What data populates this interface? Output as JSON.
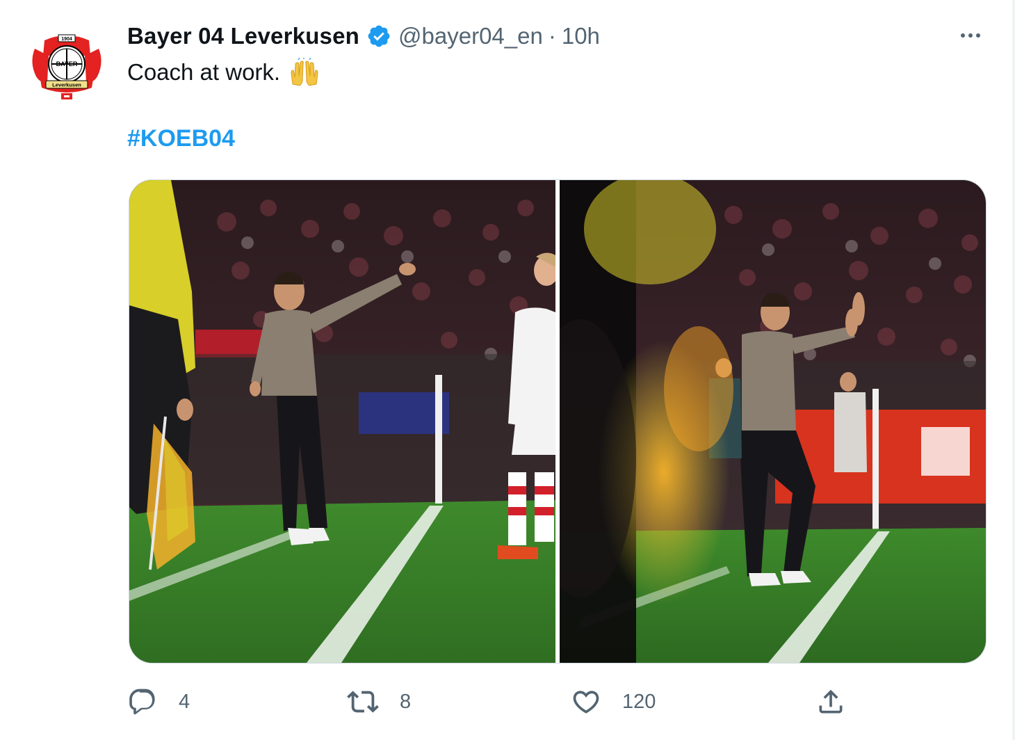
{
  "tweet": {
    "display_name": "Bayer 04 Leverkusen",
    "handle": "@bayer04_en",
    "separator": "·",
    "time": "10h",
    "text": "Coach at work.",
    "emoji": "🙌",
    "hashtag": "#KOEB04",
    "verified": true,
    "avatar_icon": "bayer-leverkusen-crest",
    "crest_text": {
      "top": "1904",
      "middle": "BAYER",
      "bottom": "Leverkusen"
    },
    "photos": [
      {
        "name": "coach-pointing-photo"
      },
      {
        "name": "coach-gesturing-photo"
      }
    ],
    "actions": {
      "reply": {
        "icon": "reply-icon",
        "count": "4"
      },
      "retweet": {
        "icon": "retweet-icon",
        "count": "8"
      },
      "like": {
        "icon": "heart-icon",
        "count": "120"
      },
      "share": {
        "icon": "share-icon"
      }
    },
    "colors": {
      "name": "#0f1419",
      "secondary": "#536471",
      "hashtag": "#1d9bf0",
      "verified": "#1d9bf0",
      "crest_red": "#e32221"
    }
  }
}
